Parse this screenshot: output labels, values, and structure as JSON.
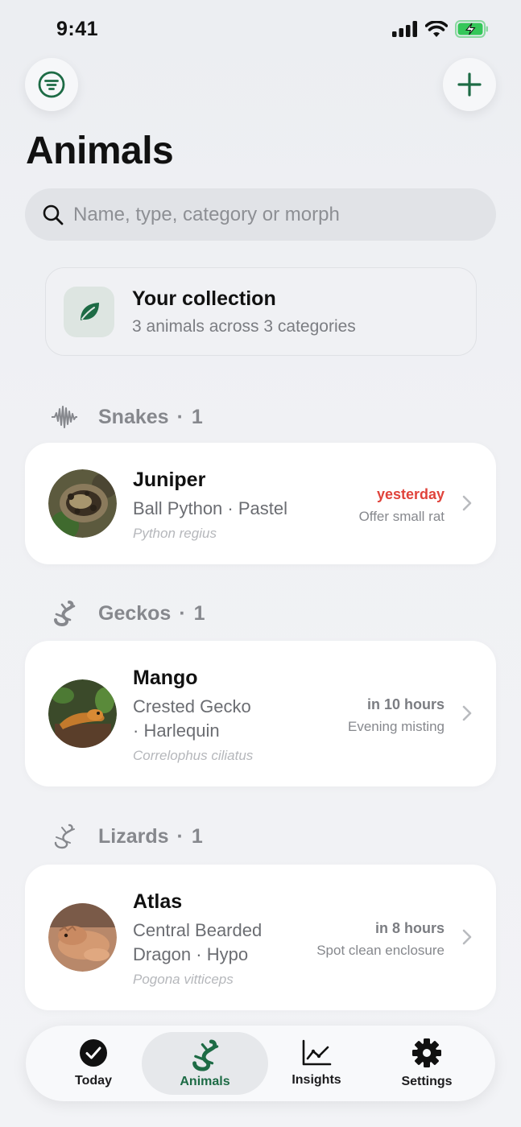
{
  "status": {
    "time": "9:41"
  },
  "header": {
    "title": "Animals"
  },
  "search": {
    "placeholder": "Name, type, category or morph"
  },
  "collection": {
    "title": "Your collection",
    "subtitle": "3 animals across 3 categories"
  },
  "sections": [
    {
      "label": "Snakes",
      "count": "1",
      "icon": "snake-wave-icon",
      "animal": {
        "name": "Juniper",
        "description": "Ball Python · Pastel",
        "scientific": "Python regius",
        "task_when": "yesterday",
        "task_what": "Offer small rat",
        "overdue": true
      }
    },
    {
      "label": "Geckos",
      "count": "1",
      "icon": "gecko-icon",
      "animal": {
        "name": "Mango",
        "description_line1": "Crested Gecko",
        "description_line2": "· Harlequin",
        "scientific": "Correlophus ciliatus",
        "task_when": "in 10 hours",
        "task_what": "Evening misting"
      }
    },
    {
      "label": "Lizards",
      "count": "1",
      "icon": "lizard-icon",
      "animal": {
        "name": "Atlas",
        "description_line1": "Central Bearded",
        "description_line2": "Dragon · Hypo",
        "scientific": "Pogona vitticeps",
        "task_when": "in 8 hours",
        "task_what": "Spot clean enclosure"
      }
    }
  ],
  "tabs": [
    {
      "label": "Today",
      "icon": "checkmark-circle-icon"
    },
    {
      "label": "Animals",
      "icon": "gecko-icon",
      "active": true
    },
    {
      "label": "Insights",
      "icon": "chart-line-icon"
    },
    {
      "label": "Settings",
      "icon": "gear-icon"
    }
  ],
  "colors": {
    "accent": "#1d6b45",
    "overdue": "#e0433b",
    "background": "#eef0f3"
  }
}
